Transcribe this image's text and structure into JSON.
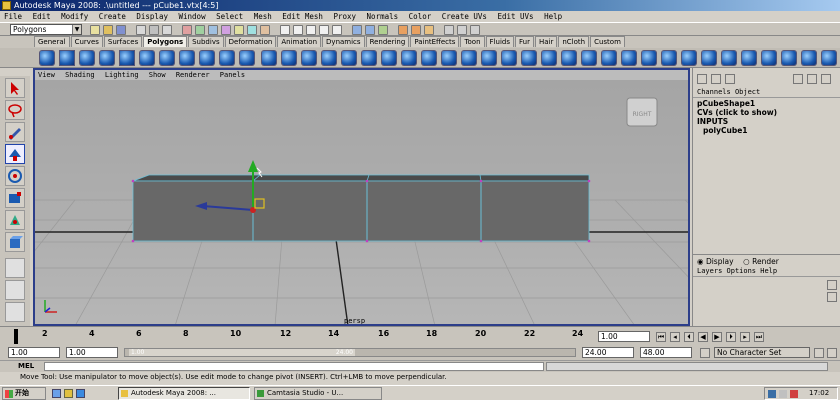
{
  "window": {
    "title": "Autodesk Maya 2008: .\\untitled   ---   pCube1.vtx[4:5]"
  },
  "menubar": {
    "items": [
      "File",
      "Edit",
      "Modify",
      "Create",
      "Display",
      "Window",
      "Select",
      "Mesh",
      "Edit Mesh",
      "Proxy",
      "Normals",
      "Color",
      "Create UVs",
      "Edit UVs",
      "Help"
    ]
  },
  "statusline": {
    "menu_set": "Polygons"
  },
  "shelf": {
    "tabs": [
      "General",
      "Curves",
      "Surfaces",
      "Polygons",
      "Subdivs",
      "Deformation",
      "Animation",
      "Dynamics",
      "Rendering",
      "PaintEffects",
      "Toon",
      "Fluids",
      "Fur",
      "Hair",
      "nCloth",
      "Custom"
    ],
    "active_tab": "Polygons"
  },
  "viewport": {
    "panel_menu": [
      "View",
      "Shading",
      "Lighting",
      "Show",
      "Renderer",
      "Panels"
    ],
    "view_cube_label": "RIGHT",
    "camera_label": "persp"
  },
  "channel_box": {
    "tabs": [
      "Channels",
      "Object"
    ],
    "shape_node": "pCubeShape1",
    "cvs_hint": "CVs (click to show)",
    "inputs_label": "INPUTS",
    "input_node": "polyCube1"
  },
  "layer_editor": {
    "display_radio": "Display",
    "render_radio": "Render",
    "menu": [
      "Layers",
      "Options",
      "Help"
    ]
  },
  "timeline": {
    "ticks": [
      "2",
      "4",
      "6",
      "8",
      "10",
      "12",
      "14",
      "16",
      "18",
      "20",
      "22",
      "24"
    ],
    "current_frame": "1.00"
  },
  "range": {
    "start_time": "1.00",
    "start_range": "1.00",
    "slider_start": "1.00",
    "slider_end": "24.00",
    "end_range": "24.00",
    "end_time": "48.00",
    "character_set": "No Character Set"
  },
  "cmdline": {
    "label": "MEL"
  },
  "helpline": {
    "text": "Move Tool: Use manipulator to move object(s). Use edit mode to change pivot (INSERT). Ctrl+LMB to move perpendicular."
  },
  "taskbar": {
    "start": "开始",
    "tasks": [
      "Autodesk Maya 2008: ...",
      "Camtasia Studio - U..."
    ],
    "clock": "17:02"
  }
}
